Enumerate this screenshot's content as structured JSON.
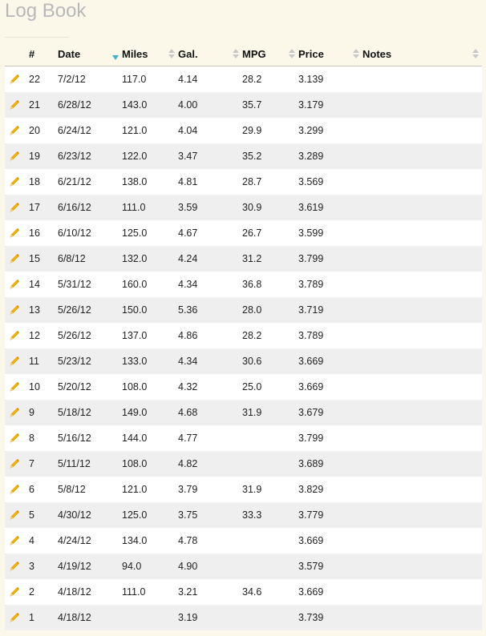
{
  "page": {
    "title": "Log Book"
  },
  "table": {
    "columns": {
      "num": "#",
      "date": "Date",
      "miles": "Miles",
      "gal": "Gal.",
      "mpg": "MPG",
      "price": "Price",
      "notes": "Notes"
    },
    "sorted_by": "Date",
    "sort_direction": "descending",
    "rows": [
      {
        "num": "22",
        "date": "7/2/12",
        "miles": "117.0",
        "gal": "4.14",
        "mpg": "28.2",
        "price": "3.139",
        "notes": ""
      },
      {
        "num": "21",
        "date": "6/28/12",
        "miles": "143.0",
        "gal": "4.00",
        "mpg": "35.7",
        "price": "3.179",
        "notes": ""
      },
      {
        "num": "20",
        "date": "6/24/12",
        "miles": "121.0",
        "gal": "4.04",
        "mpg": "29.9",
        "price": "3.299",
        "notes": ""
      },
      {
        "num": "19",
        "date": "6/23/12",
        "miles": "122.0",
        "gal": "3.47",
        "mpg": "35.2",
        "price": "3.289",
        "notes": ""
      },
      {
        "num": "18",
        "date": "6/21/12",
        "miles": "138.0",
        "gal": "4.81",
        "mpg": "28.7",
        "price": "3.569",
        "notes": ""
      },
      {
        "num": "17",
        "date": "6/16/12",
        "miles": "111.0",
        "gal": "3.59",
        "mpg": "30.9",
        "price": "3.619",
        "notes": ""
      },
      {
        "num": "16",
        "date": "6/10/12",
        "miles": "125.0",
        "gal": "4.67",
        "mpg": "26.7",
        "price": "3.599",
        "notes": ""
      },
      {
        "num": "15",
        "date": "6/8/12",
        "miles": "132.0",
        "gal": "4.24",
        "mpg": "31.2",
        "price": "3.799",
        "notes": ""
      },
      {
        "num": "14",
        "date": "5/31/12",
        "miles": "160.0",
        "gal": "4.34",
        "mpg": "36.8",
        "price": "3.789",
        "notes": ""
      },
      {
        "num": "13",
        "date": "5/26/12",
        "miles": "150.0",
        "gal": "5.36",
        "mpg": "28.0",
        "price": "3.719",
        "notes": ""
      },
      {
        "num": "12",
        "date": "5/26/12",
        "miles": "137.0",
        "gal": "4.86",
        "mpg": "28.2",
        "price": "3.789",
        "notes": ""
      },
      {
        "num": "11",
        "date": "5/23/12",
        "miles": "133.0",
        "gal": "4.34",
        "mpg": "30.6",
        "price": "3.669",
        "notes": ""
      },
      {
        "num": "10",
        "date": "5/20/12",
        "miles": "108.0",
        "gal": "4.32",
        "mpg": "25.0",
        "price": "3.669",
        "notes": ""
      },
      {
        "num": "9",
        "date": "5/18/12",
        "miles": "149.0",
        "gal": "4.68",
        "mpg": "31.9",
        "price": "3.679",
        "notes": ""
      },
      {
        "num": "8",
        "date": "5/16/12",
        "miles": "144.0",
        "gal": "4.77",
        "mpg": "",
        "price": "3.799",
        "notes": ""
      },
      {
        "num": "7",
        "date": "5/11/12",
        "miles": "108.0",
        "gal": "4.82",
        "mpg": "",
        "price": "3.689",
        "notes": ""
      },
      {
        "num": "6",
        "date": "5/8/12",
        "miles": "121.0",
        "gal": "3.79",
        "mpg": "31.9",
        "price": "3.829",
        "notes": ""
      },
      {
        "num": "5",
        "date": "4/30/12",
        "miles": "125.0",
        "gal": "3.75",
        "mpg": "33.3",
        "price": "3.779",
        "notes": ""
      },
      {
        "num": "4",
        "date": "4/24/12",
        "miles": "134.0",
        "gal": "4.78",
        "mpg": "",
        "price": "3.669",
        "notes": ""
      },
      {
        "num": "3",
        "date": "4/19/12",
        "miles": "94.0",
        "gal": "4.90",
        "mpg": "",
        "price": "3.579",
        "notes": ""
      },
      {
        "num": "2",
        "date": "4/18/12",
        "miles": "111.0",
        "gal": "3.21",
        "mpg": "34.6",
        "price": "3.669",
        "notes": ""
      },
      {
        "num": "1",
        "date": "4/18/12",
        "miles": "",
        "gal": "3.19",
        "mpg": "",
        "price": "3.739",
        "notes": ""
      }
    ]
  },
  "icons": {
    "edit": "pencil-icon"
  },
  "colors": {
    "background": "#fbf8ea",
    "row_alt": "#efefef",
    "sort_active": "#3fb3c6",
    "pencil": "#f2b400"
  }
}
